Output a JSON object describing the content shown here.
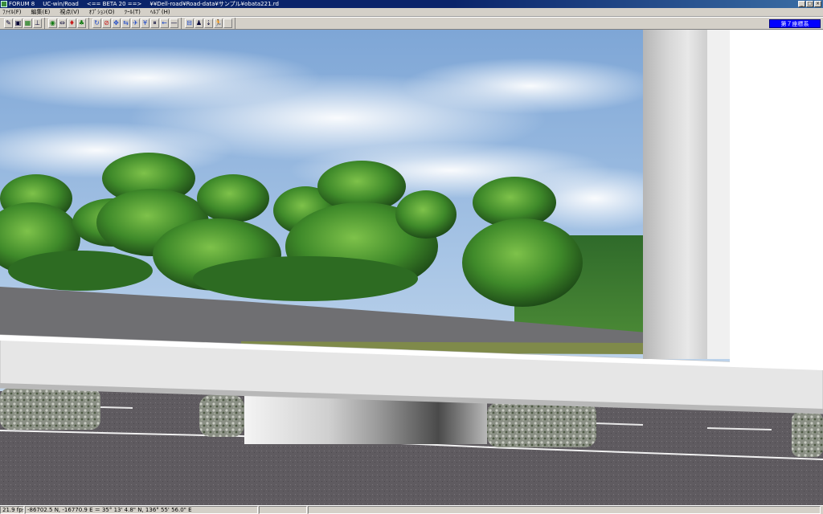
{
  "window": {
    "app_name": "FORUM 8",
    "product": "UC-win/Road",
    "version": "<== BETA 20 ==>",
    "file_path": "¥¥Dell-road¥Road-data¥サンプル¥obata221.rd",
    "controls": [
      "_",
      "□",
      "×"
    ]
  },
  "menu": [
    {
      "label": "ﾌｧｲﾙ(F)"
    },
    {
      "label": "編集(E)"
    },
    {
      "label": "視点(V)"
    },
    {
      "label": "ｵﾌﾟｼｮﾝ(O)"
    },
    {
      "label": "ﾂｰﾙ(T)"
    },
    {
      "label": "ﾍﾙﾌﾟ(H)"
    }
  ],
  "toolbar": {
    "groups": [
      [
        {
          "icon": "pen-icon",
          "glyph": "✎"
        },
        {
          "icon": "camera-icon",
          "glyph": "▣"
        },
        {
          "icon": "grid-icon",
          "glyph": "▦"
        },
        {
          "icon": "road-icon",
          "glyph": "⊥"
        }
      ],
      [
        {
          "icon": "pointer-icon",
          "glyph": "◉"
        },
        {
          "icon": "arrows-icon",
          "glyph": "⇔"
        },
        {
          "icon": "shield-icon",
          "glyph": "♦"
        },
        {
          "icon": "tree-icon",
          "glyph": "♣"
        }
      ],
      [
        {
          "icon": "rotate-icon",
          "glyph": "↻"
        },
        {
          "icon": "stop-icon",
          "glyph": "⊘"
        },
        {
          "icon": "move-icon",
          "glyph": "✥"
        },
        {
          "icon": "pan-icon",
          "glyph": "⇆"
        },
        {
          "icon": "fly-icon",
          "glyph": "✈"
        },
        {
          "icon": "figure-icon",
          "glyph": "¥"
        },
        {
          "icon": "pause-icon",
          "glyph": "⏸"
        },
        {
          "icon": "back-icon",
          "glyph": "←"
        },
        {
          "icon": "blank-icon",
          "glyph": "—"
        }
      ],
      [
        {
          "icon": "grid-fit-icon",
          "glyph": "⊟"
        },
        {
          "icon": "person-icon",
          "glyph": "♟"
        },
        {
          "icon": "walker-icon",
          "glyph": "⇣"
        },
        {
          "icon": "runner-icon",
          "glyph": "🏃"
        },
        {
          "icon": "empty-icon",
          "glyph": ""
        }
      ]
    ],
    "mode_label": "第７座標系"
  },
  "status": {
    "fps": "21.9 fps",
    "coords": "-86702.5 N, -16770.9 E",
    "latlon": "35° 13' 4.8\" N, 136° 55' 56.0\" E"
  }
}
